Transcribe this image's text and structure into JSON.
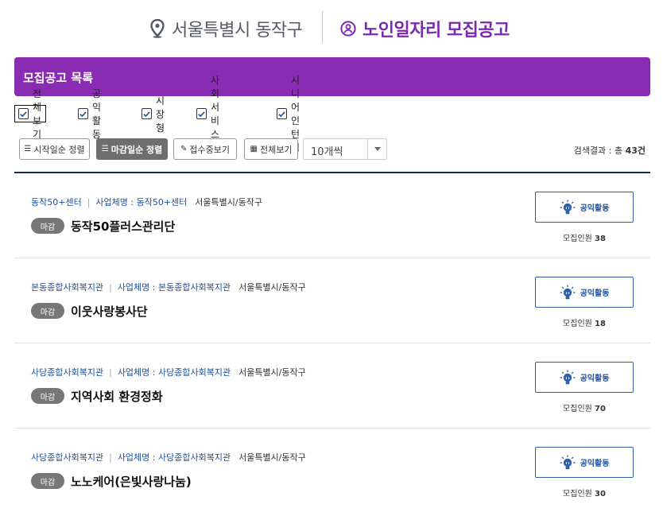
{
  "header": {
    "region": "서울특별시 동작구",
    "region_icon": "location-pin-icon",
    "title": "노인일자리 모집공고",
    "title_icon": "person-circle-icon"
  },
  "banner": {
    "title": "모집공고 목록"
  },
  "filters": [
    {
      "label": "전체보기",
      "checked": true
    },
    {
      "label": "공익활동",
      "checked": true
    },
    {
      "label": "시장형",
      "checked": true
    },
    {
      "label": "사회서비스형",
      "checked": true
    },
    {
      "label": "시니어인턴십",
      "checked": true
    }
  ],
  "toolbar": {
    "buttons": [
      {
        "label": "시작일순 정렬",
        "icon": "list-icon",
        "active": false
      },
      {
        "label": "마감일순 정렬",
        "icon": "list-icon",
        "active": true
      },
      {
        "label": "접수중보기",
        "icon": "pencil-icon",
        "active": false
      },
      {
        "label": "전체보기",
        "icon": "grid-icon",
        "active": false
      }
    ],
    "page_size": "10개씩",
    "result_prefix": "검색결과 : 총 ",
    "result_count": "43건"
  },
  "colors": {
    "accent": "#8a2bb3",
    "link": "#1d4f9c",
    "badge": "#777777"
  },
  "items": [
    {
      "org": "동작50+센터",
      "business": "사업체명 : 동작50+센터",
      "location": "서울특별시/동작구",
      "status": "마감",
      "title": "동작50플러스관리단",
      "category": "공익활동",
      "recruit_label": "모집인원 ",
      "recruit_count": "38"
    },
    {
      "org": "본동종합사회복지관",
      "business": "사업체명 : 본동종합사회복지관",
      "location": "서울특별시/동작구",
      "status": "마감",
      "title": "이웃사랑봉사단",
      "category": "공익활동",
      "recruit_label": "모집인원 ",
      "recruit_count": "18"
    },
    {
      "org": "사당종합사회복지관",
      "business": "사업체명 : 사당종합사회복지관",
      "location": "서울특별시/동작구",
      "status": "마감",
      "title": "지역사회 환경정화",
      "category": "공익활동",
      "recruit_label": "모집인원 ",
      "recruit_count": "70"
    },
    {
      "org": "사당종합사회복지관",
      "business": "사업체명 : 사당종합사회복지관",
      "location": "서울특별시/동작구",
      "status": "마감",
      "title": "노노케어(은빛사랑나눔)",
      "category": "공익활동",
      "recruit_label": "모집인원 ",
      "recruit_count": "30"
    }
  ]
}
